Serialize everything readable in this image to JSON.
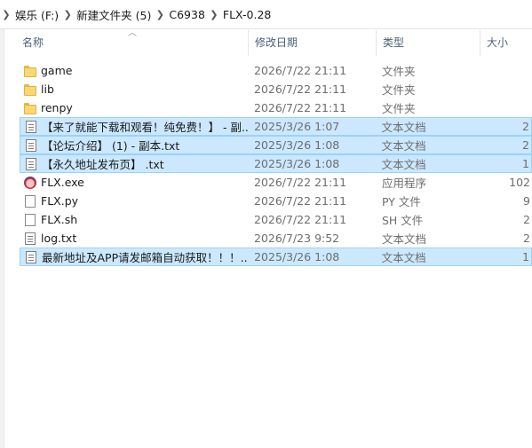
{
  "breadcrumb": [
    "娱乐 (F:)",
    "新建文件夹 (5)",
    "C6938",
    "FLX-0.28"
  ],
  "columns": {
    "name": "名称",
    "date": "修改日期",
    "type": "类型",
    "size": "大小"
  },
  "files": [
    {
      "name": "game",
      "date": "2026/7/22 21:11",
      "type": "文件夹",
      "size": "",
      "icon": "folder-icon",
      "selected": false
    },
    {
      "name": "lib",
      "date": "2026/7/22 21:11",
      "type": "文件夹",
      "size": "",
      "icon": "folder-icon",
      "selected": false
    },
    {
      "name": "renpy",
      "date": "2026/7/22 21:11",
      "type": "文件夹",
      "size": "",
      "icon": "folder-icon",
      "selected": false
    },
    {
      "name": "【来了就能下载和观看！纯免费！】 - 副...",
      "date": "2025/3/26 1:07",
      "type": "文本文档",
      "size": "2",
      "icon": "text-document-icon",
      "selected": true
    },
    {
      "name": "【论坛介绍】 (1) - 副本.txt",
      "date": "2025/3/26 1:08",
      "type": "文本文档",
      "size": "2",
      "icon": "text-document-icon",
      "selected": true
    },
    {
      "name": "【永久地址发布页】 .txt",
      "date": "2025/3/26 1:08",
      "type": "文本文档",
      "size": "1",
      "icon": "text-document-icon",
      "selected": true
    },
    {
      "name": "FLX.exe",
      "date": "2026/7/22 21:11",
      "type": "应用程序",
      "size": "102",
      "icon": "application-icon",
      "selected": false
    },
    {
      "name": "FLX.py",
      "date": "2026/7/22 21:11",
      "type": "PY 文件",
      "size": "9",
      "icon": "file-icon",
      "selected": false
    },
    {
      "name": "FLX.sh",
      "date": "2026/7/22 21:11",
      "type": "SH 文件",
      "size": "2",
      "icon": "file-icon",
      "selected": false
    },
    {
      "name": "log.txt",
      "date": "2026/7/23 9:52",
      "type": "文本文档",
      "size": "2",
      "icon": "text-document-icon",
      "selected": false
    },
    {
      "name": "最新地址及APP请发邮箱自动获取！！！...",
      "date": "2025/3/26 1:08",
      "type": "文本文档",
      "size": "1",
      "icon": "text-document-icon",
      "selected": true
    }
  ]
}
